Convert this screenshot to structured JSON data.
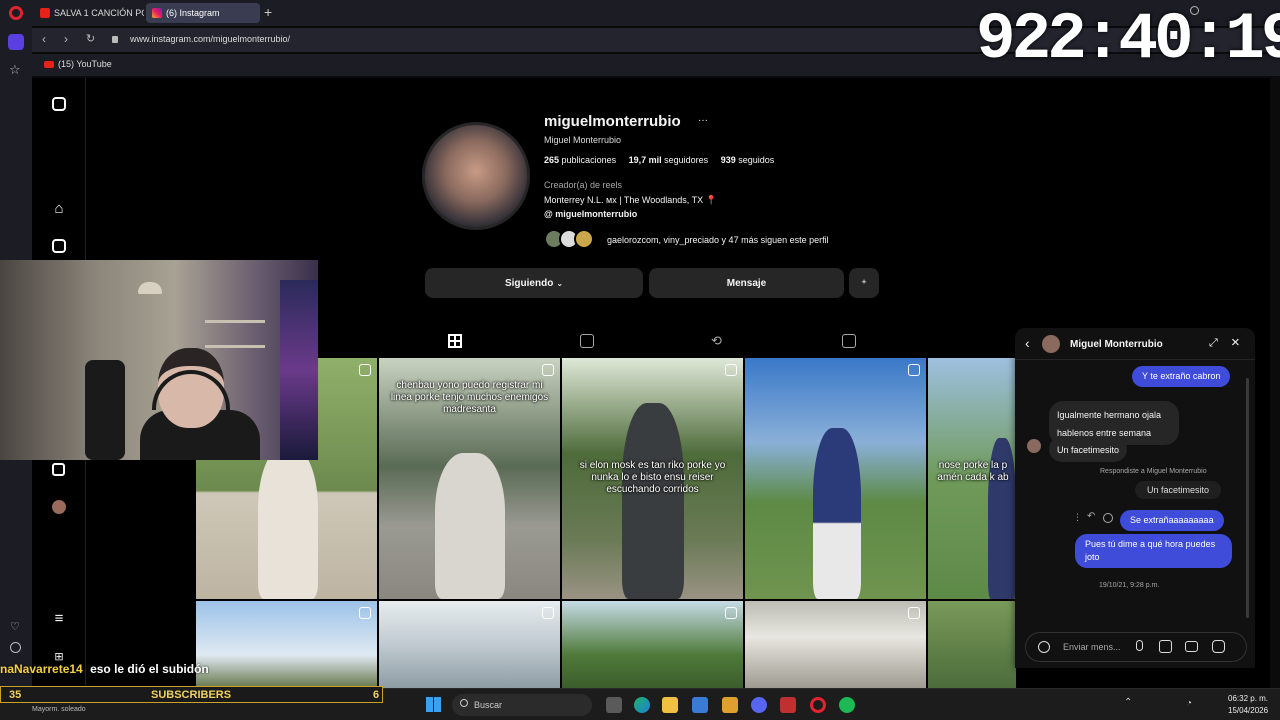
{
  "browser": {
    "tabs": [
      {
        "label": "SALVA 1 CANCIÓN POR C",
        "icon": "youtube-icon"
      },
      {
        "label": "(6) Instagram",
        "icon": "instagram-icon"
      }
    ],
    "url": "www.instagram.com/miguelmonterrubio/",
    "bookmarks": [
      {
        "label": "(15) YouTube",
        "icon": "youtube-icon"
      }
    ]
  },
  "clock_overlay": "922:40:19",
  "profile": {
    "username": "miguelmonterrubio",
    "more": "···",
    "display_name": "Miguel Monterrubio",
    "stats": {
      "posts_count": "265",
      "posts_label": "publicaciones",
      "followers_count": "19,7 mil",
      "followers_label": "seguidores",
      "following_count": "939",
      "following_label": "seguidos"
    },
    "category": "Creador(a) de reels",
    "bio": "Monterrey N.L. ᴍx | The Woodlands, TX 📍",
    "threads_handle": "miguelmonterrubio",
    "followed_by": "gaelorozcom, viny_preciado y 47 más siguen este perfil",
    "buttons": {
      "following": "Siguiendo",
      "message": "Mensaje"
    }
  },
  "posts": [
    {
      "caption": ""
    },
    {
      "caption": "chenbau yono puedo registrar mi linea porke tenjo muchos enemigos madresanta"
    },
    {
      "caption": "si elon mosk es tan riko porke yo nunka lo e bisto ensu reiser escuchando corridos"
    },
    {
      "caption": ""
    },
    {
      "caption": "nose porke la p amén cada k ab"
    }
  ],
  "chat": {
    "title": "Miguel Monterrubio",
    "messages": {
      "m1": "Y te extraño cabron",
      "m2": "Igualmente hermano ojala hablenos entre semana",
      "m3": "Un facetimesito",
      "reply_note": "Respondiste a Miguel Monterrubio",
      "quoted": "Un facetimesito",
      "m4": "Se extrañaaaaaaaaa",
      "m5": "Pues tú dime a qué hora puedes joto"
    },
    "timestamp": "19/10/21, 9:28 p.m.",
    "input_placeholder": "Enviar mens..."
  },
  "stream": {
    "chat_user": "naNavarrete14",
    "chat_message": "eso le dió el subidón",
    "sub_count_left": "35",
    "sub_label": "SUBSCRIBERS",
    "sub_count_right": "6"
  },
  "taskbar": {
    "search_label": "Buscar",
    "time": "06:32 p. m.",
    "date": "15/04/2026",
    "weather": "Mayorm. soleado"
  },
  "colors": {
    "accent_blue": "#3f4bd9",
    "tab_active": "#3a3c52",
    "subs_gold": "#c9a227"
  }
}
